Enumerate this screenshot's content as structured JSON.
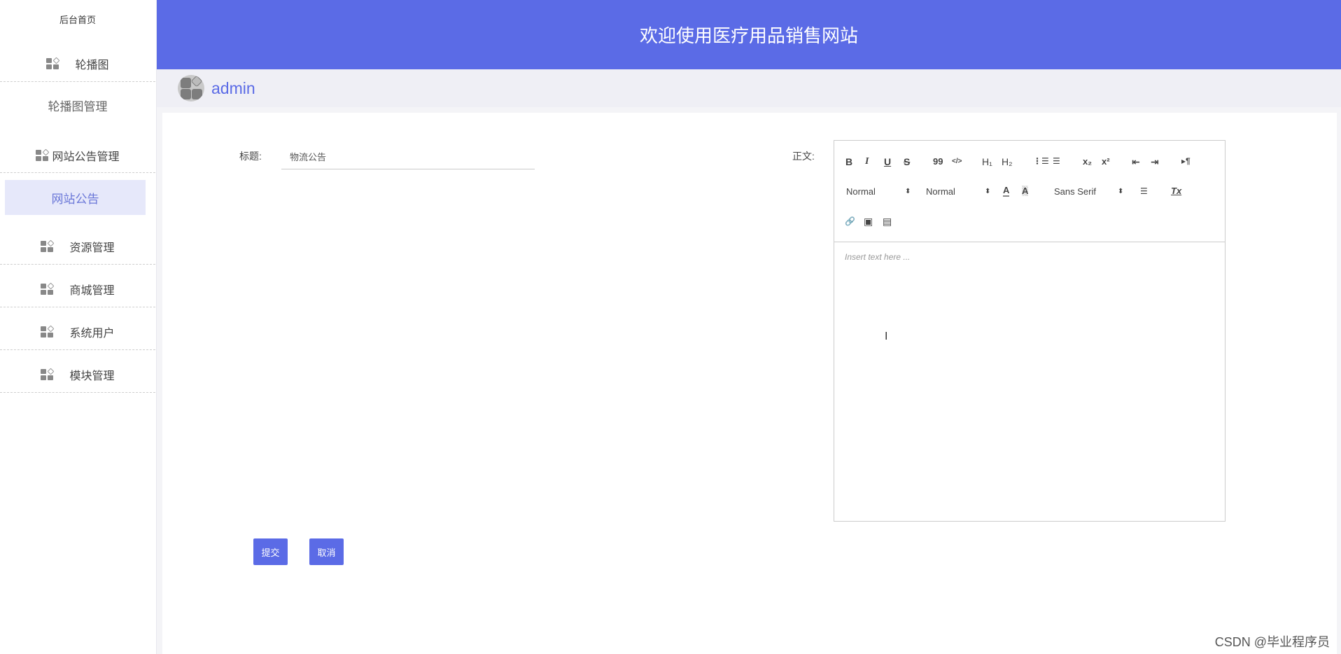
{
  "sidebar": {
    "home": "后台首页",
    "items": [
      {
        "label": "轮播图",
        "icon": "grid-icon"
      },
      {
        "label": "轮播图管理"
      },
      {
        "label": "网站公告管理",
        "icon": "grid-icon"
      },
      {
        "label": "网站公告",
        "active": true
      },
      {
        "label": "资源管理",
        "icon": "grid-icon"
      },
      {
        "label": "商城管理",
        "icon": "grid-icon"
      },
      {
        "label": "系统用户",
        "icon": "grid-icon"
      },
      {
        "label": "模块管理",
        "icon": "grid-icon"
      }
    ]
  },
  "header": {
    "title": "欢迎使用医疗用品销售网站"
  },
  "user": {
    "name": "admin"
  },
  "form": {
    "title_label": "标题:",
    "title_value": "物流公告",
    "body_label": "正文:",
    "submit": "提交",
    "cancel": "取消"
  },
  "editor": {
    "header_select": "Normal",
    "size_select": "Normal",
    "font_select": "Sans Serif",
    "placeholder": "Insert text here ...",
    "tools": {
      "bold": "B",
      "italic": "I",
      "underline": "U",
      "strike": "S",
      "quote": "99",
      "code": "</>",
      "h1": "H₁",
      "h2": "H₂",
      "ol": "⋮☰",
      "ul": "☰",
      "sub": "x₂",
      "sup": "x²",
      "outdent": "⇤",
      "indent": "⇥",
      "direction": "▸¶",
      "color": "A",
      "background": "A",
      "align": "☰",
      "clean": "Tx",
      "link": "🔗",
      "image": "▣",
      "video": "▤"
    }
  },
  "colors": {
    "accent": "#5b6be6",
    "active_bg": "#e6e8fa"
  },
  "watermark": "CSDN @毕业程序员"
}
